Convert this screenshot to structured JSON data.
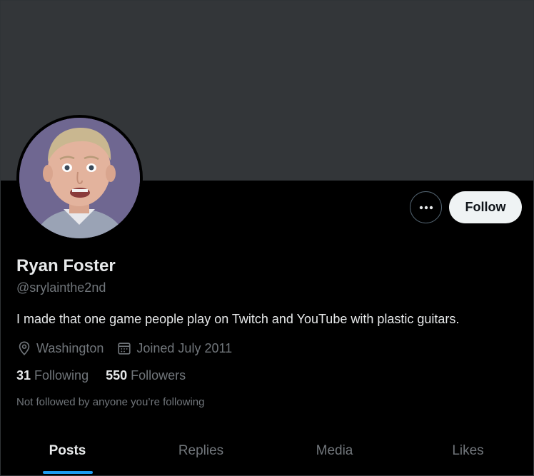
{
  "profile": {
    "name": "Ryan Foster",
    "handle": "@srylainthe2nd",
    "bio": "I made that one game people play on Twitch and YouTube with plastic guitars.",
    "location": "Washington",
    "joined": "Joined July 2011",
    "following_count": "31",
    "following_label": "Following",
    "followers_count": "550",
    "followers_label": "Followers",
    "not_followed_text": "Not followed by anyone you’re following"
  },
  "actions": {
    "follow_label": "Follow",
    "more_icon": "ellipsis-icon"
  },
  "icons": {
    "location": "location-pin-icon",
    "calendar": "calendar-icon"
  },
  "tabs": [
    {
      "label": "Posts",
      "active": true
    },
    {
      "label": "Replies",
      "active": false
    },
    {
      "label": "Media",
      "active": false
    },
    {
      "label": "Likes",
      "active": false
    }
  ],
  "colors": {
    "banner": "#333639",
    "background": "#000000",
    "accent": "#1d9bf0",
    "secondary_text": "#71767b"
  }
}
